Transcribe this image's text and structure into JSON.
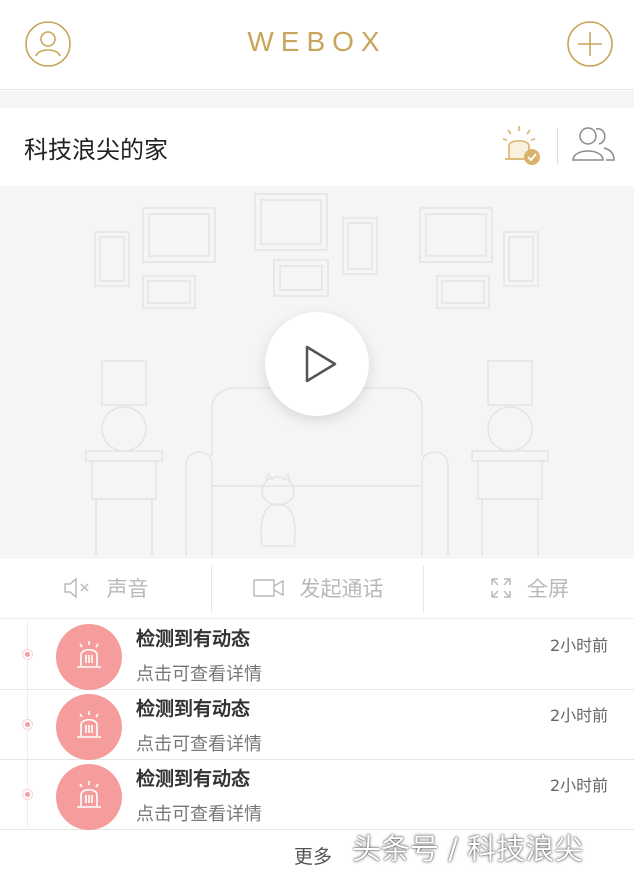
{
  "header": {
    "brand": "WEBOX",
    "left_icon": "user-profile-icon",
    "right_icon": "plus-icon",
    "accent_color": "#c9a55c"
  },
  "home": {
    "title": "科技浪尖的家",
    "alarm_icon": "alarm-armed-icon",
    "members_icon": "users-icon"
  },
  "video": {
    "play_icon": "play-icon"
  },
  "controls": [
    {
      "label": "声音",
      "icon": "speaker-muted-icon"
    },
    {
      "label": "发起通话",
      "icon": "video-camera-icon"
    },
    {
      "label": "全屏",
      "icon": "fullscreen-icon"
    }
  ],
  "events": [
    {
      "title": "检测到有动态",
      "subtitle": "点击可查看详情",
      "time": "2小时前",
      "icon": "alarm-siren-icon"
    },
    {
      "title": "检测到有动态",
      "subtitle": "点击可查看详情",
      "time": "2小时前",
      "icon": "alarm-siren-icon"
    },
    {
      "title": "检测到有动态",
      "subtitle": "点击可查看详情",
      "time": "2小时前",
      "icon": "alarm-siren-icon"
    }
  ],
  "footer": {
    "more_label": "更多",
    "watermark": "头条号 / 科技浪尖"
  },
  "colors": {
    "event_badge": "#f59d9d",
    "muted_text": "#b9b9b9"
  }
}
